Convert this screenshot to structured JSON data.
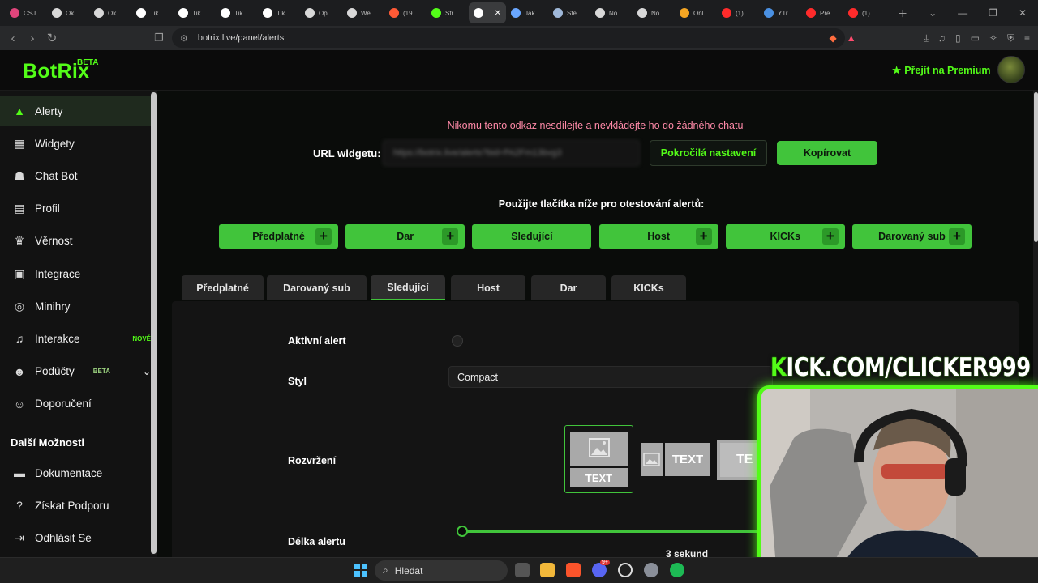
{
  "browser": {
    "tabs": [
      {
        "label": "CSJ",
        "color": "#e0457b"
      },
      {
        "label": "Ok",
        "color": "#d8d8d8"
      },
      {
        "label": "Ok",
        "color": "#d8d8d8"
      },
      {
        "label": "Tik",
        "color": "#ffffff"
      },
      {
        "label": "Tik",
        "color": "#ffffff"
      },
      {
        "label": "Tik",
        "color": "#ffffff"
      },
      {
        "label": "Tik",
        "color": "#ffffff"
      },
      {
        "label": "Op",
        "color": "#d8d8d8"
      },
      {
        "label": "We",
        "color": "#d8d8d8"
      },
      {
        "label": "(19",
        "color": "#ff5a36"
      },
      {
        "label": "Str",
        "color": "#53fc18"
      },
      {
        "label": "",
        "color": "#ffffff",
        "active": true
      },
      {
        "label": "Jak",
        "color": "#6aa7ff"
      },
      {
        "label": "Ste",
        "color": "#9fb8d9"
      },
      {
        "label": "No",
        "color": "#d8d8d8"
      },
      {
        "label": "No",
        "color": "#d8d8d8"
      },
      {
        "label": "Onl",
        "color": "#f5a623"
      },
      {
        "label": "(1)",
        "color": "#ff2b2b"
      },
      {
        "label": "YTr",
        "color": "#4a90e2"
      },
      {
        "label": "Pře",
        "color": "#ff2b2b"
      },
      {
        "label": "(1)",
        "color": "#ff2b2b"
      }
    ],
    "url": "botrix.live/panel/alerts"
  },
  "header": {
    "logo": "BotRix",
    "logo_badge": "BETA",
    "premium_label": "Přejít na Premium"
  },
  "sidebar": {
    "items": [
      {
        "label": "Alerty",
        "icon": "alert-triangle-icon",
        "glyph": "▲",
        "active": true
      },
      {
        "label": "Widgety",
        "icon": "grid-icon",
        "glyph": "▦"
      },
      {
        "label": "Chat Bot",
        "icon": "robot-icon",
        "glyph": "☗"
      },
      {
        "label": "Profil",
        "icon": "id-card-icon",
        "glyph": "▤"
      },
      {
        "label": "Věrnost",
        "icon": "trophy-icon",
        "glyph": "♛"
      },
      {
        "label": "Integrace",
        "icon": "plug-icon",
        "glyph": "▣"
      },
      {
        "label": "Minihry",
        "icon": "gamepad-icon",
        "glyph": "◎"
      },
      {
        "label": "Interakce",
        "icon": "music-icon",
        "glyph": "♫",
        "badge": "NOVÉ"
      },
      {
        "label": "Podúčty",
        "icon": "users-icon",
        "glyph": "☻",
        "badge": "BETA"
      },
      {
        "label": "Doporučení",
        "icon": "user-icon",
        "glyph": "☺"
      }
    ],
    "section_title": "Další Možnosti",
    "extra_items": [
      {
        "label": "Dokumentace",
        "icon": "book-icon",
        "glyph": "▬"
      },
      {
        "label": "Získat Podporu",
        "icon": "help-icon",
        "glyph": "?"
      },
      {
        "label": "Odhlásit Se",
        "icon": "logout-icon",
        "glyph": "⇥"
      }
    ]
  },
  "main": {
    "warning": "Nikomu tento odkaz nesdílejte a nevkládejte ho do žádného chatu",
    "url_label": "URL widgetu:",
    "url_value": "https://botrix.live/alerts?bid=f%2Fm13bvg3",
    "advanced_button": "Pokročilá nastavení",
    "copy_button": "Kopírovat",
    "test_label": "Použijte tlačítka níže pro otestování alertů:",
    "test_buttons": [
      {
        "label": "Předplatné",
        "plus": true
      },
      {
        "label": "Dar",
        "plus": true
      },
      {
        "label": "Sledující",
        "plus": false
      },
      {
        "label": "Host",
        "plus": true
      },
      {
        "label": "KICKs",
        "plus": true
      },
      {
        "label": "Darovaný sub",
        "plus": true
      }
    ],
    "tabs": [
      {
        "label": "Předplatné"
      },
      {
        "label": "Darovaný sub"
      },
      {
        "label": "Sledující",
        "active": true
      },
      {
        "label": "Host"
      },
      {
        "label": "Dar"
      },
      {
        "label": "KICKs"
      }
    ],
    "form": {
      "active_alert_label": "Aktivní alert",
      "active_alert_on": false,
      "style_label": "Styl",
      "style_value": "Compact",
      "layout_label": "Rozvržení",
      "layout_text": "TEXT",
      "layout_text_cut": "TE",
      "duration_label": "Délka alertu",
      "duration_value": "3  sekund"
    }
  },
  "overlay": {
    "channel_k": "K",
    "channel_rest": "ICK.COM/CLICKER999"
  },
  "taskbar": {
    "search_placeholder": "Hledat",
    "mail_badge": "9+"
  },
  "colors": {
    "accent": "#53fc18",
    "button_green": "#41c43b",
    "warning": "#ff8aa8"
  }
}
